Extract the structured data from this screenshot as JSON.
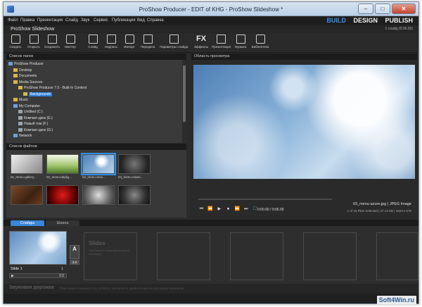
{
  "window": {
    "title": "ProShow Producer - EDIT of KHG - ProShow Slideshow *",
    "controls": [
      "–",
      "□",
      "✕"
    ]
  },
  "menu": [
    "Файл",
    "Правка",
    "Презентация",
    "Слайд",
    "Звук",
    "Сервис",
    "Публикация",
    "Вид",
    "Справка"
  ],
  "modes": {
    "build": "BUILD",
    "design": "DESIGN",
    "publish": "PUBLISH"
  },
  "project": {
    "title": "ProShow Slideshow",
    "stats": "1 слайд (0:06.00)"
  },
  "toolbar": [
    {
      "label": "Создать",
      "icon": "new-icon"
    },
    {
      "label": "Открыть",
      "icon": "open-icon"
    },
    {
      "label": "Сохранить",
      "icon": "save-icon"
    },
    {
      "label": "Мастер",
      "icon": "wizard-icon"
    },
    {
      "label": "Слайд",
      "icon": "slide-icon"
    },
    {
      "label": "Надпись",
      "icon": "caption-icon"
    },
    {
      "label": "Импорт",
      "icon": "import-icon"
    },
    {
      "label": "Передача",
      "icon": "transfer-icon"
    },
    {
      "label": "Параметры слайда",
      "icon": "slide-options-icon"
    },
    {
      "label": "Эффекты",
      "icon": "fx-icon",
      "glyph": "FX"
    },
    {
      "label": "Презентация",
      "icon": "show-icon"
    },
    {
      "label": "Музыка",
      "icon": "music-icon"
    },
    {
      "label": "Библиотека",
      "icon": "library-icon"
    }
  ],
  "folders": {
    "header": "Список папок",
    "items": [
      {
        "label": "ProShow Producer",
        "type": "pc",
        "depth": 0
      },
      {
        "label": "Desktop",
        "type": "folder",
        "depth": 1
      },
      {
        "label": "Documents",
        "type": "folder",
        "depth": 1
      },
      {
        "label": "Media Sources",
        "type": "folder",
        "depth": 1
      },
      {
        "label": "ProShow Producer 7.0 - Built-In Content",
        "type": "folder",
        "depth": 2
      },
      {
        "label": "Backgrounds",
        "type": "folder",
        "depth": 3,
        "selected": true
      },
      {
        "label": "Music",
        "type": "folder",
        "depth": 1
      },
      {
        "label": "My Computer",
        "type": "pc",
        "depth": 1
      },
      {
        "label": "Untitled (C:)",
        "type": "drive",
        "depth": 2
      },
      {
        "label": "Компакт-диск (E:)",
        "type": "drive",
        "depth": 2
      },
      {
        "label": "Новый том (F:)",
        "type": "drive",
        "depth": 2
      },
      {
        "label": "Компакт-диск (G:)",
        "type": "drive",
        "depth": 2
      },
      {
        "label": "Network",
        "type": "pc",
        "depth": 1
      }
    ]
  },
  "files": {
    "header": "Список файлов",
    "items": [
      {
        "caption": "01_menu-gallery...",
        "bg": "linear-gradient(135deg,#eee,#bbb 50%,#888)"
      },
      {
        "caption": "02_menu-daylig...",
        "bg": "linear-gradient(#f3f8e8,#9fc46a 60%,#4f7a2a)"
      },
      {
        "caption": "03_menu-azur...",
        "bg": "radial-gradient(circle at 60% 35%,#fff 0 12%,transparent 35%),linear-gradient(135deg,#4f83bb,#b8d3ec)",
        "selected": true
      },
      {
        "caption": "04_menu-classi...",
        "bg": "radial-gradient(circle,#777 0,#222 75%)"
      },
      {
        "caption": "",
        "bg": "linear-gradient(135deg,#7a4a28,#3d2212 60%,#6a3c1e)"
      },
      {
        "caption": "",
        "bg": "radial-gradient(circle,#e01c1c 0,#5a0000 70%,#1a0000)"
      },
      {
        "caption": "",
        "bg": "radial-gradient(circle,#ddd 0,#777 55%,#333)"
      },
      {
        "caption": "",
        "bg": "radial-gradient(circle,#888 0,#333 60%,#111)"
      }
    ]
  },
  "preview": {
    "header": "Область просмотра",
    "time": "0:00.00 / 0:06.00",
    "filename": "03_menu-azure.jpg",
    "filetype": "JPEG Image",
    "stats": "1 of 16 Files Selected | 27.13 KB | 1024 x 576",
    "controls": [
      "⏮",
      "⏪",
      "▶",
      "⏹",
      "⏩",
      "⏭",
      "⛶"
    ]
  },
  "tabs": {
    "slides": "Слайды",
    "timeline": "Шкала"
  },
  "slides": {
    "slide1_label": "Slide 1",
    "slide1_number": "1",
    "slide1_duration": "3.0",
    "transition_glyph": "A",
    "transition_duration": "3.0",
    "placeholder_title": "Slides",
    "placeholder_hint": "Перетащите сюда фотографии или видео"
  },
  "soundtrack": {
    "title": "Звуковая дорожка",
    "hint": "Перетащите музыку в эту область. Выполните двойной щелчок для редактирования."
  },
  "watermark": "Soft4Win.ru"
}
